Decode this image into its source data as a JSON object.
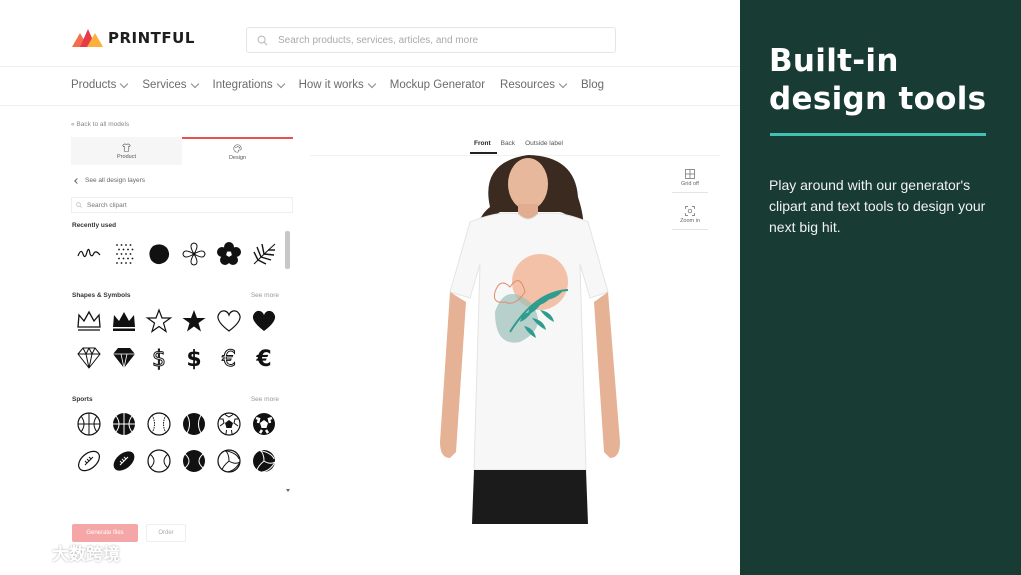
{
  "header": {
    "brand": "PRINTFUL",
    "search_placeholder": "Search products, services, articles, and more"
  },
  "nav": {
    "items": [
      {
        "label": "Products",
        "dropdown": true
      },
      {
        "label": "Services",
        "dropdown": true
      },
      {
        "label": "Integrations",
        "dropdown": true
      },
      {
        "label": "How it works",
        "dropdown": true
      },
      {
        "label": "Mockup Generator",
        "dropdown": false
      },
      {
        "label": "Resources",
        "dropdown": true
      },
      {
        "label": "Blog",
        "dropdown": false
      }
    ]
  },
  "editor": {
    "back_link": "« Back to all models",
    "tabs": [
      {
        "label": "Product",
        "icon": "tshirt-icon",
        "active": false
      },
      {
        "label": "Design",
        "icon": "palette-icon",
        "active": true
      }
    ],
    "layers_link": "See all design layers",
    "clipart_search_placeholder": "Search clipart",
    "sections": [
      {
        "title": "Recently used",
        "see_more": "",
        "icons": [
          "signature-icon",
          "dots-pattern-icon",
          "blob-icon",
          "hibiscus-icon",
          "flower-icon",
          "palm-leaf-icon"
        ]
      },
      {
        "title": "Shapes & Symbols",
        "see_more": "See more",
        "icons": [
          "crown-outline-icon",
          "crown-icon",
          "star-outline-icon",
          "star-icon",
          "heart-outline-icon",
          "heart-icon",
          "diamond-outline-icon",
          "diamond-icon",
          "dollar-outline-icon",
          "dollar-icon",
          "euro-outline-icon",
          "euro-icon"
        ]
      },
      {
        "title": "Sports",
        "see_more": "See more",
        "icons": [
          "basketball-outline-icon",
          "basketball-icon",
          "baseball-outline-icon",
          "baseball-icon",
          "soccer-ball-outline-icon",
          "soccer-ball-icon",
          "football-outline-icon",
          "football-icon",
          "tennis-ball-outline-icon",
          "tennis-ball-icon",
          "volleyball-outline-icon",
          "volleyball-icon"
        ]
      }
    ],
    "primary_button": "Generate files",
    "secondary_button": "Order"
  },
  "preview": {
    "view_tabs": [
      {
        "label": "Front",
        "active": true
      },
      {
        "label": "Back",
        "active": false
      },
      {
        "label": "Outside label",
        "active": false
      }
    ],
    "tools": [
      {
        "label": "Grid off",
        "icon": "grid-icon"
      },
      {
        "label": "Zoom in",
        "icon": "zoom-icon"
      }
    ]
  },
  "banner": {
    "title": "Built-in design tools",
    "body": "Play around with our generator's clipart and text tools to design your next big hit.",
    "background": "#183b33",
    "accent": "#3fc1b5"
  },
  "watermark": "大数跨境",
  "colors": {
    "primary_red": "#e65252",
    "primary_button_disabled": "#f5a6a6"
  }
}
